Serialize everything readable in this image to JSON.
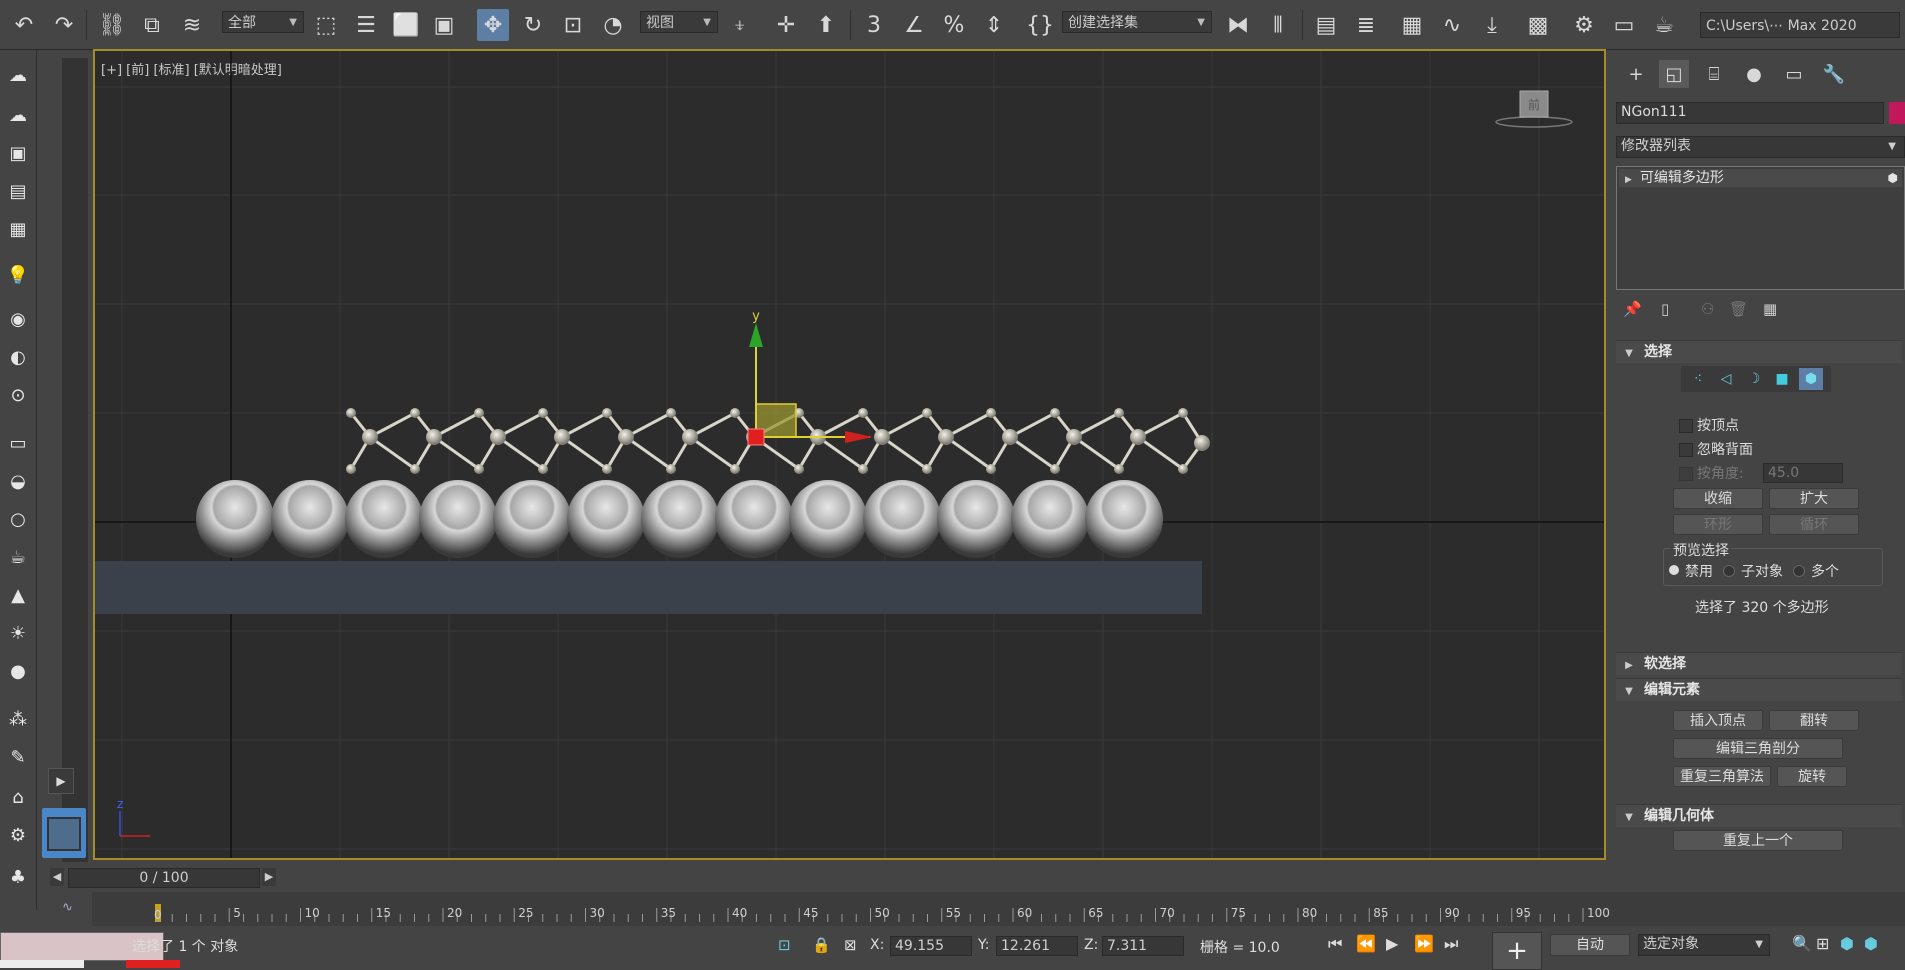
{
  "toolbar": {
    "selection_filter": "全部",
    "ref_coord": "视图",
    "named_selection_set": "创建选择集",
    "project_path": "C:\\Users\\⋯ Max 2020",
    "icons": [
      "undo-icon",
      "redo-icon",
      "link-icon",
      "unlink-icon",
      "bind-spacewarp-icon",
      "select-object-icon",
      "select-by-name-icon",
      "rect-selection-icon",
      "window-crossing-icon",
      "move-icon",
      "rotate-icon",
      "scale-icon",
      "placement-icon",
      "use-pivot-icon",
      "select-manipulate-icon",
      "keyboard-shortcut-icon",
      "snap-3d-icon",
      "angle-snap-icon",
      "percent-snap-icon",
      "spinner-snap-icon",
      "edit-named-sets-icon",
      "mirror-icon",
      "align-icon",
      "scene-explorer-icon",
      "layer-explorer-icon",
      "toggle-ribbon-icon",
      "curve-editor-icon",
      "schematic-view-icon",
      "material-editor-icon",
      "render-setup-icon",
      "rendered-frame-icon",
      "render-production-icon",
      "render-iterative-icon"
    ]
  },
  "viewport": {
    "label": "[+] [前] [标准] [默认明暗处理]",
    "viewcube_face": "前",
    "gizmo_axis_y": "y",
    "axis_tripod_z": "z"
  },
  "command_panel": {
    "object_name": "NGon111",
    "modifier_list": "修改器列表",
    "stack_item": "可编辑多边形",
    "selection_rollout": {
      "title": "选择",
      "by_vertex": "按顶点",
      "ignore_backfacing": "忽略背面",
      "by_angle": "按角度:",
      "angle_value": "45.0",
      "shrink": "收缩",
      "grow": "扩大",
      "ring": "环形",
      "loop": "循环",
      "preview_title": "预览选择",
      "preview_off": "禁用",
      "preview_subobj": "子对象",
      "preview_multi": "多个",
      "status": "选择了 320 个多边形"
    },
    "soft_selection": "软选择",
    "edit_elements": {
      "title": "编辑元素",
      "insert_vertex": "插入顶点",
      "flip": "翻转",
      "edit_triangulation": "编辑三角剖分",
      "retriangulate": "重复三角算法",
      "turn": "旋转"
    },
    "edit_geometry": {
      "title": "编辑几何体",
      "repeat_last": "重复上一个"
    }
  },
  "timeline": {
    "frame_counter": "0 / 100",
    "ticks": [
      "5",
      "10",
      "15",
      "20",
      "25",
      "30",
      "35",
      "40",
      "45",
      "50",
      "55",
      "60",
      "65",
      "70",
      "75",
      "80",
      "85",
      "90",
      "95",
      "100"
    ],
    "first_tick": "0"
  },
  "status_bar": {
    "selection_text": "选择了 1 个 对象",
    "x_label": "X:",
    "x_value": "49.155",
    "y_label": "Y:",
    "y_value": "12.261",
    "z_label": "Z:",
    "z_value": "7.311",
    "grid": "栅格 = 10.0",
    "auto_key": "自动",
    "key_filter": "选定对象"
  },
  "colors": {
    "viewport_border": "#a48d29",
    "object_color": "#c0185a",
    "active_tool": "#5d7fa6"
  }
}
